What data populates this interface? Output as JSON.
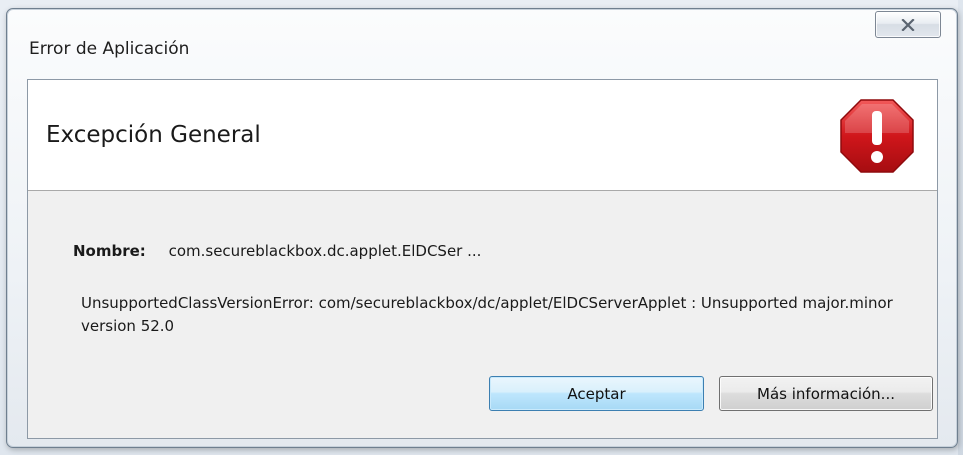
{
  "window": {
    "title": "Error de Aplicación",
    "close_icon": "close-x-icon"
  },
  "header": {
    "title": "Excepción General",
    "icon": "error-stop-icon",
    "icon_color": "#d0161b"
  },
  "details": {
    "name_label": "Nombre:",
    "name_value": "com.secureblackbox.dc.applet.ElDCSer ...",
    "message": "UnsupportedClassVersionError: com/secureblackbox/dc/applet/ElDCServerApplet : Unsupported major.minor version 52.0"
  },
  "buttons": {
    "ok_label": "Aceptar",
    "more_label": "Más información..."
  }
}
